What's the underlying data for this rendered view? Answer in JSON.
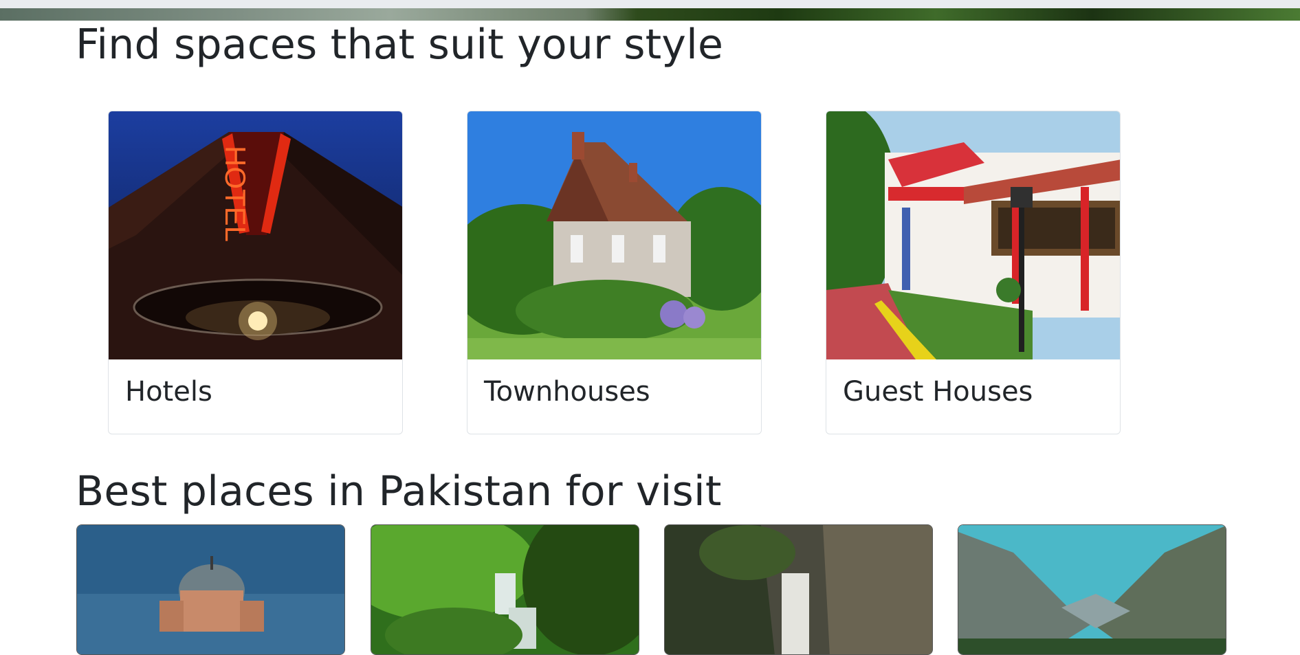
{
  "sections": {
    "styles_title": "Find spaces that suit your style",
    "places_title": "Best places in Pakistan for visit"
  },
  "style_cards": [
    {
      "label": "Hotels",
      "image": "neon-hotel-sign-photo"
    },
    {
      "label": "Townhouses",
      "image": "stone-cottage-photo"
    },
    {
      "label": "Guest Houses",
      "image": "guest-house-photo"
    }
  ],
  "place_cards": [
    {
      "image": "mosque-dome-photo"
    },
    {
      "image": "forest-waterfall-photo"
    },
    {
      "image": "canyon-waterfall-photo"
    },
    {
      "image": "mountain-valley-photo"
    }
  ]
}
